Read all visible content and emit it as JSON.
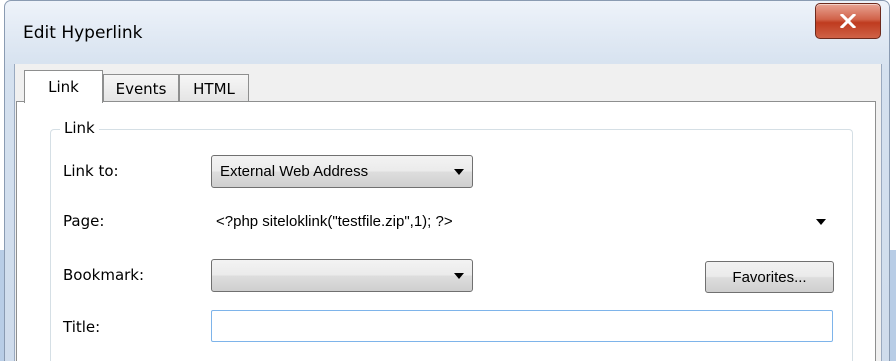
{
  "window": {
    "title": "Edit Hyperlink",
    "close_icon": "close-icon"
  },
  "tabs": [
    {
      "label": "Link",
      "active": true
    },
    {
      "label": "Events",
      "active": false
    },
    {
      "label": "HTML",
      "active": false
    }
  ],
  "link_group": {
    "legend": "Link",
    "link_to": {
      "label": "Link to:",
      "value": "External Web Address"
    },
    "page": {
      "label": "Page:",
      "value": "<?php siteloklink(\"testfile.zip\",1); ?>"
    },
    "bookmark": {
      "label": "Bookmark:",
      "value": ""
    },
    "favorites_button": "Favorites...",
    "title_field": {
      "label": "Title:",
      "value": ""
    }
  },
  "colors": {
    "close_button": "#c8452a",
    "textbox_focus_border": "#7eb4ea"
  }
}
